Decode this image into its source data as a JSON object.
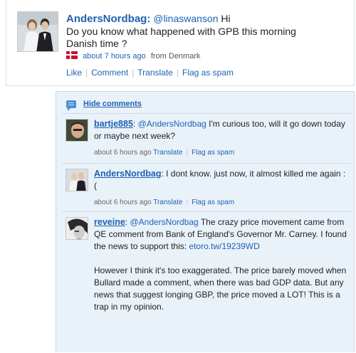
{
  "post": {
    "author": "AndersNordbag",
    "mention": "@linaswanson",
    "greeting": "Hi",
    "text": "Do you know what happened with GPB this morning\nDanish time ?",
    "time": "about 7 hours ago",
    "location": "from Denmark",
    "actions": {
      "like": "Like",
      "comment": "Comment",
      "translate": "Translate",
      "flag": "Flag as spam"
    }
  },
  "comments_panel": {
    "hide_label": "Hide comments",
    "comments": [
      {
        "author": "bartje885",
        "mention": "@AndersNordbag",
        "text": "I'm curious too, will it go down today or maybe next week?",
        "time": "about 6 hours ago",
        "translate": "Translate",
        "flag": "Flag as spam"
      },
      {
        "author": "AndersNordbag",
        "text": "I dont know. just now, it almost killed me again :(",
        "time": "about 6 hours ago",
        "translate": "Translate",
        "flag": "Flag as spam"
      },
      {
        "author": "reveine",
        "mention": "@AndersNordbag",
        "text": "The crazy price movement came from QE comment from Bank of England's Governor Mr. Carney. I found the news to support this:",
        "link": "etoro.tw/19239WD",
        "text2": "However I think it's too exaggerated. The price barely moved when Bullard made a comment, when there was bad GDP data. But any news that suggest longing GBP, the price moved a LOT! This is a trap in my opinion."
      }
    ]
  },
  "colors": {
    "link": "#1e62b3",
    "panel_bg": "#eaf2f9",
    "flag_red": "#c8102e"
  }
}
